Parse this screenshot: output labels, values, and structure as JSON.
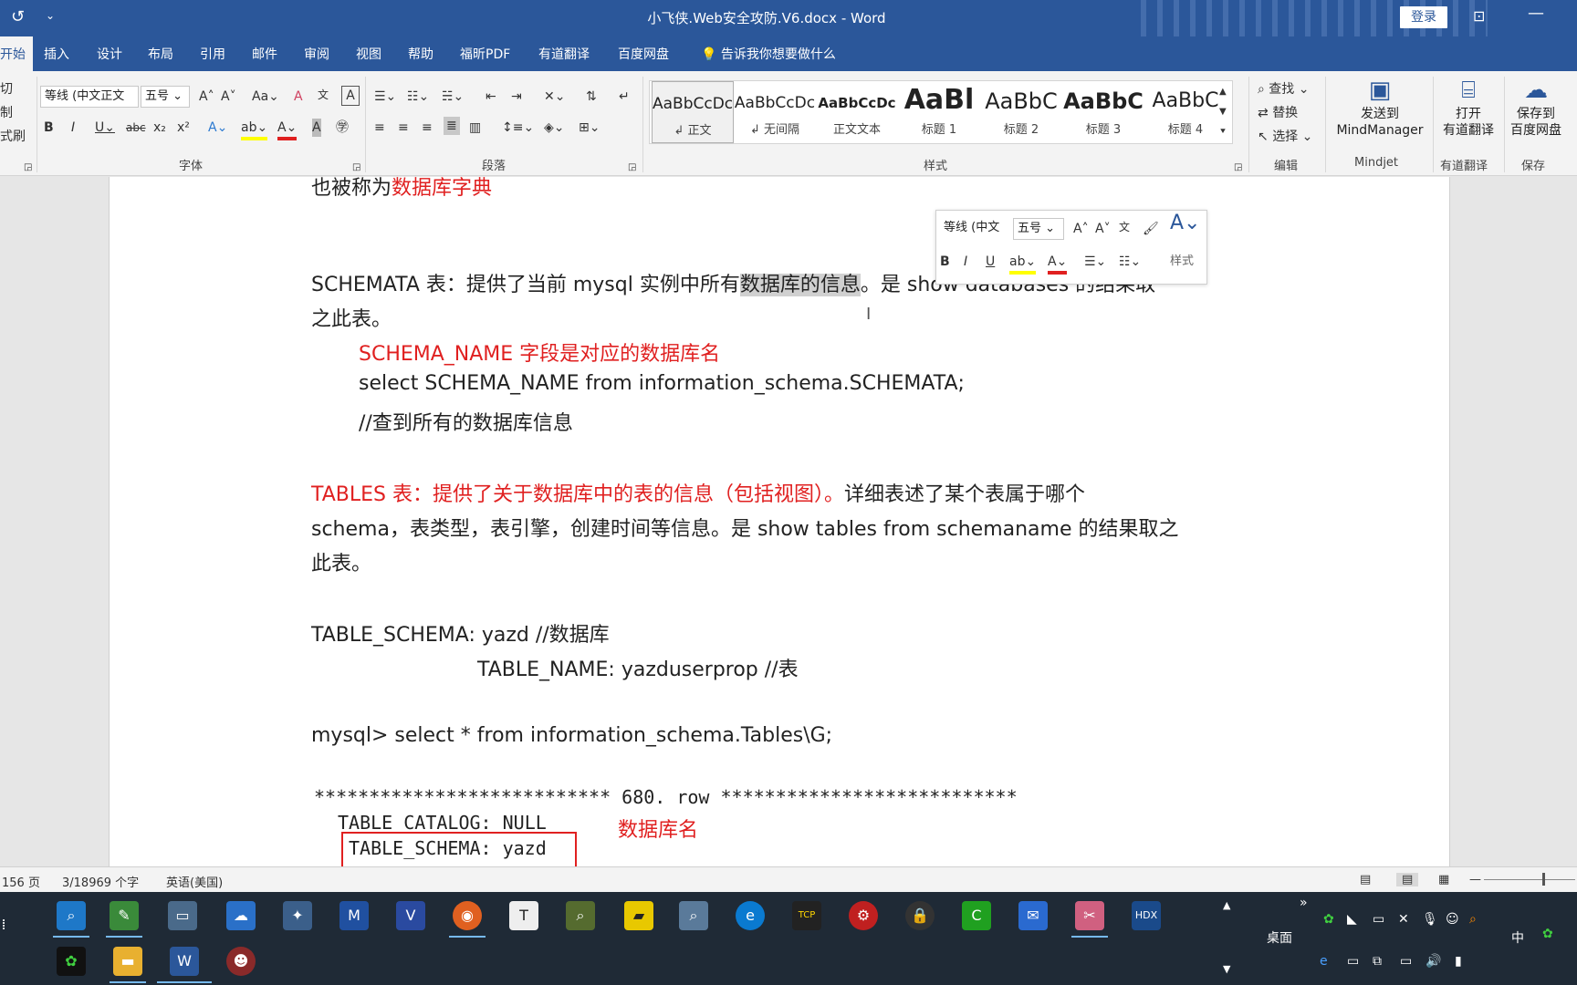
{
  "window": {
    "title": "小飞侠.Web安全攻防.V6.docx  -  Word",
    "login_label": "登录",
    "undo_icon": "↺",
    "qat_icon": "⌄"
  },
  "tabs": [
    {
      "label": "开始",
      "active": true
    },
    {
      "label": "插入"
    },
    {
      "label": "设计"
    },
    {
      "label": "布局"
    },
    {
      "label": "引用"
    },
    {
      "label": "邮件"
    },
    {
      "label": "审阅"
    },
    {
      "label": "视图"
    },
    {
      "label": "帮助"
    },
    {
      "label": "福昕PDF"
    },
    {
      "label": "有道翻译"
    },
    {
      "label": "百度网盘"
    },
    {
      "label": "告诉我你想要做什么"
    }
  ],
  "clipboard": {
    "cut": "切",
    "copy": "制",
    "format_painter": "式刷"
  },
  "font_group": {
    "font_name": "等线 (中文正文",
    "font_size": "五号",
    "label": "字体"
  },
  "paragraph_group": {
    "label": "段落"
  },
  "styles_group": {
    "label": "样式",
    "items": [
      {
        "sample": "AaBbCcDc",
        "label": "↲ 正文",
        "selected": true
      },
      {
        "sample": "AaBbCcDc",
        "label": "↲ 无间隔"
      },
      {
        "sample": "AaBbCcDc",
        "label": "正文文本"
      },
      {
        "sample": "AaBl",
        "label": "标题 1"
      },
      {
        "sample": "AaBbC",
        "label": "标题 2"
      },
      {
        "sample": "AaBbC",
        "label": "标题 3"
      },
      {
        "sample": "AaBbC",
        "label": "标题 4"
      }
    ]
  },
  "editing_group": {
    "find": "查找",
    "replace": "替换",
    "select": "选择",
    "label": "编辑"
  },
  "mindjet": {
    "line1": "发送到",
    "line2": "MindManager",
    "label": "Mindjet"
  },
  "youdao": {
    "line1": "打开",
    "line2": "有道翻译",
    "label": "有道翻译"
  },
  "baidu": {
    "line1": "保存到",
    "line2": "百度网盘",
    "label": "保存"
  },
  "mini_toolbar": {
    "font_name": "等线 (中文",
    "font_size": "五号",
    "styles_label": "样式"
  },
  "document": {
    "line1_prefix": "也被称为",
    "line1_red": "数据库字典",
    "line2_a": "SCHEMATA 表：提供了当前 mysql 实例中所有",
    "line2_hl": "数据库的信息",
    "line2_b": "。是 show databases 的结果取",
    "line3": "之此表。",
    "line4": "SCHEMA_NAME 字段是对应的数据库名",
    "line5": "select SCHEMA_NAME from information_schema.SCHEMATA;",
    "line6": "//查到所有的数据库信息",
    "line7_red": "TABLES  表：提供了关于数据库中的表的信息（包括视图）。",
    "line7_b": "详细表述了某个表属于哪个",
    "line8": "schema，表类型，表引擎，创建时间等信息。是 show tables from schemaname 的结果取之",
    "line9": "此表。",
    "line10": "TABLE_SCHEMA: yazd    //数据库",
    "line11": "TABLE_NAME: yazduserprop    //表",
    "line12": "mysql> select * from information_schema.Tables\\G;",
    "line13": "*************************** 680. row ***************************",
    "line14": "TABLE_CATALOG: NULL",
    "line15": "TABLE_SCHEMA: yazd",
    "annotation": "数据库名"
  },
  "statusbar": {
    "pages": "156 页",
    "words": "3/18969 个字",
    "language": "英语(美国)"
  },
  "taskbar": {
    "desktop_label": "桌面",
    "ime": "中",
    "icons": [
      "search-app",
      "notepad",
      "remote-desktop",
      "baidu-netdisk",
      "network-tool",
      "mindmanager",
      "visio",
      "firefox",
      "typora",
      "magnifier",
      "sticky-notes",
      "search-tool",
      "edge",
      "tcp-ip-tool",
      "burp-tool",
      "lock-tool",
      "camtasia",
      "mail",
      "snip-tool",
      "hdx"
    ],
    "icons_row2": [
      "cheat-engine",
      "file-explorer",
      "word",
      "app-avatar"
    ]
  }
}
